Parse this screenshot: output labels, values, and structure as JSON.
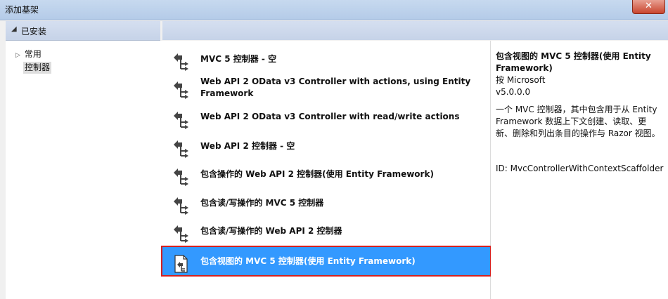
{
  "window": {
    "title": "添加基架",
    "close_label": "✕"
  },
  "tree": {
    "header": "已安装",
    "items": [
      {
        "label": "常用"
      },
      {
        "label": "控制器"
      }
    ]
  },
  "list": {
    "items": [
      {
        "label": "MVC 5 控制器 - 空",
        "icon": "controller-icon"
      },
      {
        "label": "Web API 2 OData v3 Controller with actions, using Entity Framework",
        "icon": "controller-icon"
      },
      {
        "label": "Web API 2 OData v3 Controller with read/write actions",
        "icon": "controller-icon"
      },
      {
        "label": "Web API 2 控制器 - 空",
        "icon": "controller-icon"
      },
      {
        "label": "包含操作的 Web API 2 控制器(使用 Entity Framework)",
        "icon": "controller-icon"
      },
      {
        "label": "包含读/写操作的 MVC 5 控制器",
        "icon": "controller-icon"
      },
      {
        "label": "包含读/写操作的 Web API 2 控制器",
        "icon": "controller-icon"
      },
      {
        "label": "包含视图的 MVC 5 控制器(使用 Entity Framework)",
        "icon": "view-controller-icon",
        "selected": true
      }
    ]
  },
  "details": {
    "title": "包含视图的 MVC 5 控制器(使用 Entity Framework)",
    "author": "按 Microsoft",
    "version": "v5.0.0.0",
    "description": "一个 MVC 控制器，其中包含用于从 Entity Framework 数据上下文创建、读取、更新、删除和列出条目的操作与 Razor 视图。",
    "id": "ID: MvcControllerWithContextScaffolder"
  },
  "colors": {
    "selection": "#3399ff",
    "selection_outline": "#d62020"
  }
}
